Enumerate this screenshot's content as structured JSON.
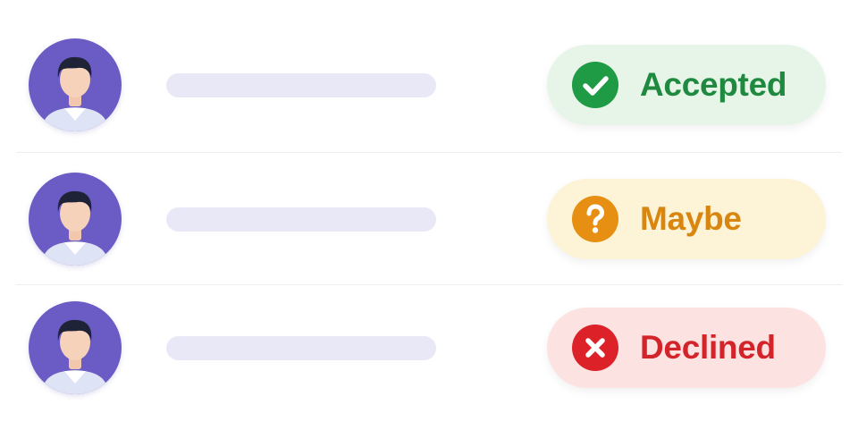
{
  "invitees": [
    {
      "status": {
        "label": "Accepted",
        "icon": "checkmark-icon",
        "colors": {
          "background": "#e6f5e8",
          "icon": "#1f9a45",
          "text": "#1f8a3f"
        }
      }
    },
    {
      "status": {
        "label": "Maybe",
        "icon": "question-mark-icon",
        "colors": {
          "background": "#fdf3d6",
          "icon": "#e68f12",
          "text": "#d98610"
        }
      }
    },
    {
      "status": {
        "label": "Declined",
        "icon": "cross-icon",
        "colors": {
          "background": "#fde2e2",
          "icon": "#dc2228",
          "text": "#d3242a"
        }
      }
    }
  ],
  "theme": {
    "avatar_background": "#6a5cc4",
    "name_placeholder": "#e9e8f6",
    "divider": "#eeeef4"
  }
}
